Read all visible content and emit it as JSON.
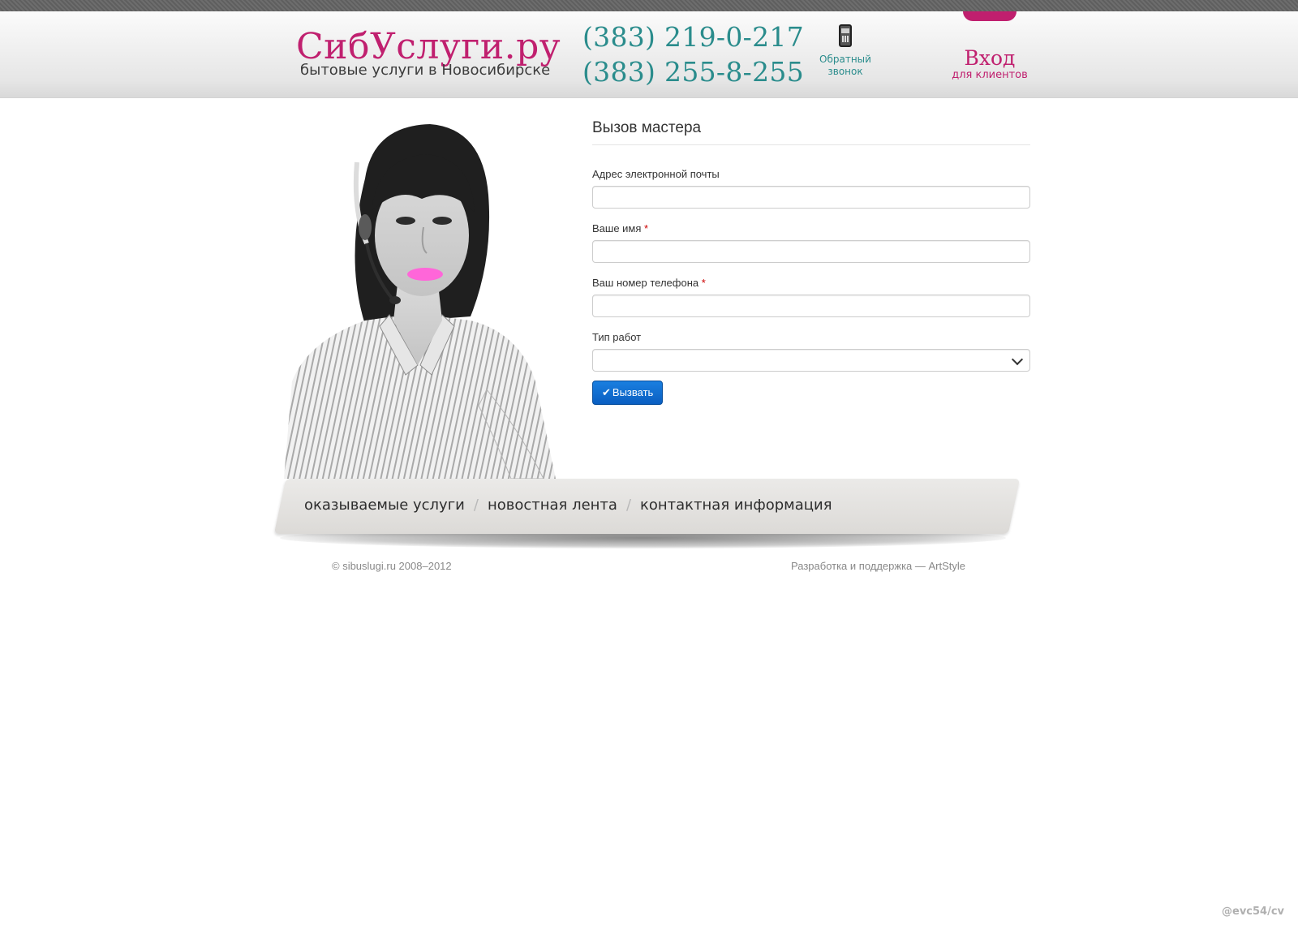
{
  "header": {
    "logo_title": "СибУслуги.ру",
    "logo_subtitle": "бытовые услуги в Новосибирске",
    "phones": [
      "(383) 219-0-217",
      "(383) 255-8-255"
    ],
    "callback_label": "Обратный звонок",
    "login_title": "Вход",
    "login_subtitle": "для клиентов",
    "accent_color": "#c0206f",
    "phone_color": "#2a8c8c"
  },
  "form": {
    "title": "Вызов мастера",
    "fields": [
      {
        "label": "Адрес электронной почты",
        "required": false,
        "value": ""
      },
      {
        "label": "Ваше имя",
        "required": true,
        "value": ""
      },
      {
        "label": "Ваш номер телефона",
        "required": true,
        "value": ""
      },
      {
        "label": "Тип работ",
        "required": false,
        "value": "",
        "type": "select"
      }
    ],
    "required_mark": "*",
    "submit_label": "Вызвать",
    "submit_icon": "check-icon"
  },
  "nav": {
    "items": [
      "оказываемые услуги",
      "новостная лента",
      "контактная информация"
    ],
    "separator": "/"
  },
  "footer": {
    "copyright": "© sibuslugi.ru 2008–2012",
    "dev_prefix": "Разработка и поддержка — ",
    "dev_link": "ArtStyle"
  },
  "watermark": "@evc54/cv"
}
